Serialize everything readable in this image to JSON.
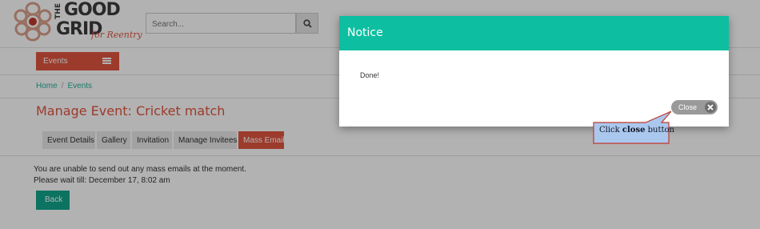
{
  "brand": {
    "logo_the": "THE",
    "logo_good": "GOOD",
    "logo_grid": "GRID",
    "logo_tagline": "for Reentry",
    "accent_color": "#e0553f",
    "teal_color": "#0dbfa0"
  },
  "search": {
    "placeholder": "Search...",
    "icon": "search-icon"
  },
  "nav": {
    "events_label": "Events",
    "menu_icon": "hamburger-icon"
  },
  "breadcrumb": {
    "items": [
      "Home",
      "Events"
    ],
    "separator": "/"
  },
  "page": {
    "title": "Manage Event: Cricket match"
  },
  "tabs": [
    {
      "label": "Event Details",
      "active": false
    },
    {
      "label": "Gallery",
      "active": false
    },
    {
      "label": "Invitation",
      "active": false
    },
    {
      "label": "Manage Invitees",
      "active": false
    },
    {
      "label": "Mass Email",
      "active": true
    }
  ],
  "content": {
    "message_line1": "You are unable to send out any mass emails at the moment.",
    "message_line2": "Please wait till: December 17, 8:02 am",
    "back_label": "Back"
  },
  "modal": {
    "title": "Notice",
    "body": "Done!",
    "close_label": "Close",
    "close_icon": "close-icon"
  },
  "callout": {
    "prefix": "Click ",
    "bold": "close",
    "suffix": " button"
  }
}
